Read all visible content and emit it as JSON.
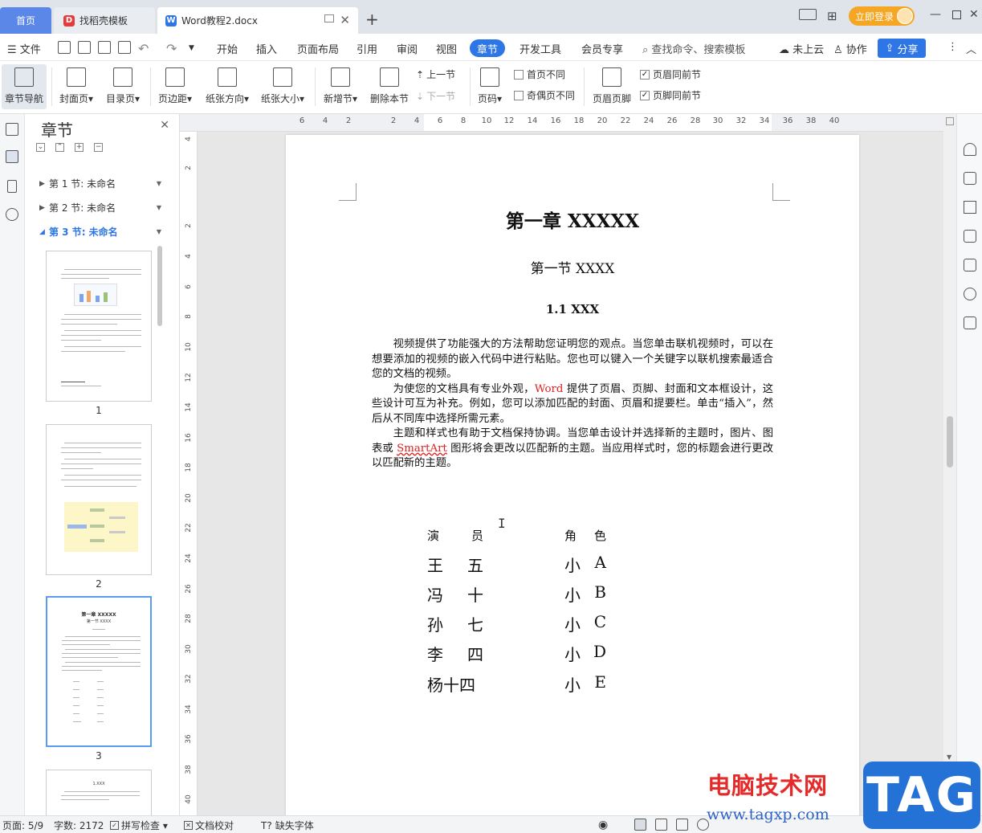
{
  "tabs": {
    "home": "首页",
    "docer": "找稻壳模板",
    "doc": "Word教程2.docx",
    "login": "立即登录"
  },
  "menu": {
    "file": "文件",
    "items": [
      "开始",
      "插入",
      "页面布局",
      "引用",
      "审阅",
      "视图",
      "章节",
      "开发工具",
      "会员专享"
    ],
    "active": "章节",
    "search": "查找命令、搜索模板",
    "cloud": "未上云",
    "collab": "协作",
    "share": "分享"
  },
  "ribbon": {
    "nav": "章节导航",
    "cover": "封面页",
    "toc": "目录页",
    "margin": "页边距",
    "orientation": "纸张方向",
    "size": "纸张大小",
    "new_section": "新增节",
    "delete_section": "删除本节",
    "prev": "上一节",
    "next": "下一节",
    "page_num": "页码",
    "diff_first": "首页不同",
    "odd_even": "奇偶页不同",
    "header_footer": "页眉页脚",
    "header_same": "页眉同前节",
    "footer_same": "页脚同前节"
  },
  "panel": {
    "title": "章节",
    "sections": [
      {
        "label": "第 1 节: 未命名"
      },
      {
        "label": "第 2 节: 未命名"
      },
      {
        "label": "第 3 节: 未命名"
      }
    ],
    "active_section": 3,
    "pages": [
      "1",
      "2",
      "3"
    ],
    "thumb3": {
      "title": "第一章 XXXXX",
      "sub": "第一节 XXXX"
    },
    "thumb4": {
      "title": "1.XXX"
    }
  },
  "ruler": {
    "h": [
      "6",
      "4",
      "2",
      "2",
      "4",
      "6",
      "8",
      "10",
      "12",
      "14",
      "16",
      "18",
      "20",
      "22",
      "24",
      "26",
      "28",
      "30",
      "32",
      "34",
      "36",
      "38",
      "40"
    ],
    "v": [
      "4",
      "2",
      "2",
      "4",
      "6",
      "8",
      "10",
      "12",
      "14",
      "16",
      "18",
      "20",
      "22",
      "24",
      "26",
      "28",
      "30",
      "32",
      "34",
      "36",
      "38",
      "40"
    ]
  },
  "document": {
    "chapter_title": "第一章  XXXXX",
    "section_title": "第一节  XXXX",
    "sub_title": "1.1 XXX",
    "p1": "视频提供了功能强大的方法帮助您证明您的观点。当您单击联机视频时，可以在想要添加的视频的嵌入代码中进行粘贴。您也可以键入一个关键字以联机搜索最适合您的文档的视频。",
    "p2_a": "为使您的文档具有专业外观，",
    "p2_word": "Word",
    "p2_b": " 提供了页眉、页脚、封面和文本框设计，这些设计可互为补充。例如，您可以添加匹配的封面、页眉和提要栏。单击“插入”，然后从不同库中选择所需元素。",
    "p3_a": "主题和样式也有助于文档保持协调。当您单击设计并选择新的主题时，图片、图表或 ",
    "p3_smartart": "SmartArt",
    "p3_b": " 图形将会更改以匹配新的主题。当应用样式时，您的标题会进行更改以匹配新的主题。",
    "cast_header": [
      [
        "演",
        "员"
      ],
      [
        "角",
        "色"
      ]
    ],
    "cast": [
      [
        [
          "王",
          "五"
        ],
        [
          "小",
          "A"
        ]
      ],
      [
        [
          "冯",
          "十"
        ],
        [
          "小",
          "B"
        ]
      ],
      [
        [
          "孙",
          "七"
        ],
        [
          "小",
          "C"
        ]
      ],
      [
        [
          "李",
          "四"
        ],
        [
          "小",
          "D"
        ]
      ],
      [
        [
          "杨十四",
          ""
        ],
        [
          "小",
          "E"
        ]
      ]
    ]
  },
  "status": {
    "page": "页面: 5/9",
    "words": "字数: 2172",
    "spell": "拼写检查",
    "proof": "文档校对",
    "missing_font": "缺失字体"
  },
  "watermark": {
    "cn": "电脑技术网",
    "url": "www.tagxp.com",
    "tag": "TAG"
  },
  "colors": {
    "accent": "#2e75e6",
    "home_tab": "#5b87e8",
    "login": "#f5a623",
    "red_text": "#e02020"
  }
}
